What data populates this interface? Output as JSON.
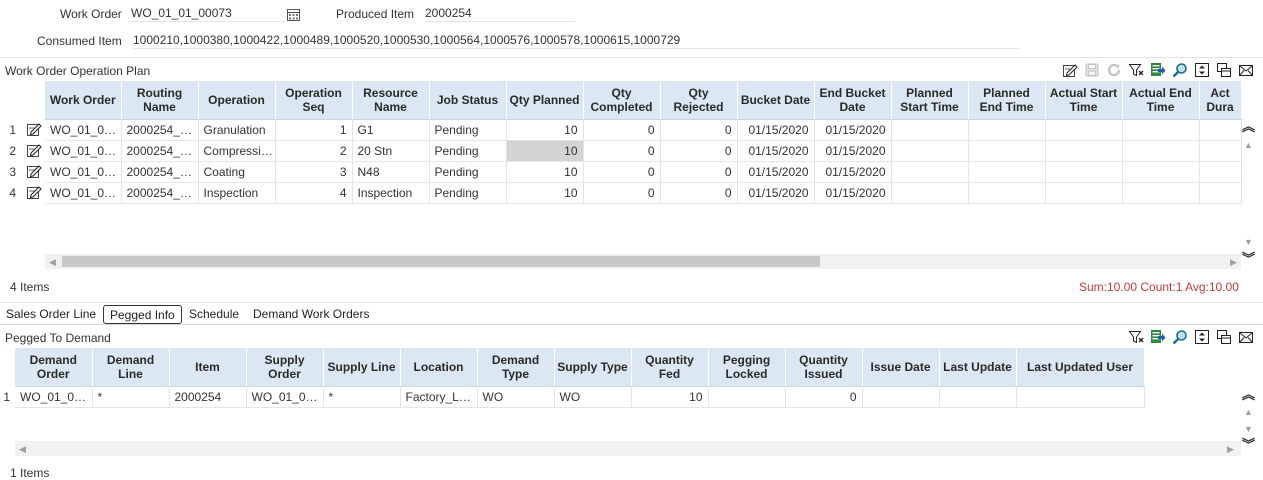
{
  "header": {
    "work_order_label": "Work Order",
    "work_order_value": "WO_01_01_00073",
    "produced_item_label": "Produced Item",
    "produced_item_value": "2000254",
    "consumed_item_label": "Consumed Item",
    "consumed_item_value": "1000210,1000380,1000422,1000489,1000520,1000530,1000564,1000576,1000578,1000615,1000729"
  },
  "op_plan": {
    "title": "Work Order Operation Plan",
    "columns": [
      "Work Order",
      "Routing Name",
      "Operation",
      "Operation Seq",
      "Resource Name",
      "Job Status",
      "Qty Planned",
      "Qty Completed",
      "Qty Rejected",
      "Bucket Date",
      "End Bucket Date",
      "Planned Start Time",
      "Planned End Time",
      "Actual Start Time",
      "Actual End Time",
      "Act Dura"
    ],
    "rows": [
      {
        "n": "1",
        "cells": [
          "WO_01_0…",
          "2000254_…",
          "Granulation",
          "1",
          "G1",
          "Pending",
          "10",
          "0",
          "0",
          "01/15/2020",
          "01/15/2020",
          "",
          "",
          "",
          "",
          ""
        ]
      },
      {
        "n": "2",
        "cells": [
          "WO_01_0…",
          "2000254_…",
          "Compressi…",
          "2",
          "20 Stn",
          "Pending",
          "10",
          "0",
          "0",
          "01/15/2020",
          "01/15/2020",
          "",
          "",
          "",
          "",
          ""
        ]
      },
      {
        "n": "3",
        "cells": [
          "WO_01_0…",
          "2000254_…",
          "Coating",
          "3",
          "N48",
          "Pending",
          "10",
          "0",
          "0",
          "01/15/2020",
          "01/15/2020",
          "",
          "",
          "",
          "",
          ""
        ]
      },
      {
        "n": "4",
        "cells": [
          "WO_01_0…",
          "2000254_…",
          "Inspection",
          "4",
          "Inspection",
          "Pending",
          "10",
          "0",
          "0",
          "01/15/2020",
          "01/15/2020",
          "",
          "",
          "",
          "",
          ""
        ]
      }
    ],
    "item_count": "4 Items",
    "summary": "Sum:10.00 Count:1 Avg:10.00"
  },
  "tabs": [
    "Sales Order Line",
    "Pegged Info",
    "Schedule",
    "Demand Work Orders"
  ],
  "active_tab": "Pegged Info",
  "pegged": {
    "title": "Pegged To Demand",
    "columns": [
      "Demand Order",
      "Demand Line",
      "Item",
      "Supply Order",
      "Supply Line",
      "Location",
      "Demand Type",
      "Supply Type",
      "Quantity Fed",
      "Pegging Locked",
      "Quantity Issued",
      "Issue Date",
      "Last Update",
      "Last Updated User"
    ],
    "rows": [
      {
        "n": "1",
        "cells": [
          "WO_01_0…",
          "*",
          "2000254",
          "WO_01_0…",
          "*",
          "Factory_L…",
          "WO",
          "WO",
          "10",
          "",
          "0",
          "",
          "",
          ""
        ]
      }
    ],
    "item_count": "1 Items"
  },
  "icons": {
    "toolbar_top": [
      "edit-icon",
      "save-icon",
      "refresh-icon",
      "filter-icon",
      "export-icon",
      "find-icon",
      "resize-icon",
      "columns-icon",
      "email-icon"
    ],
    "toolbar_bottom": [
      "filter-icon",
      "export-icon",
      "find-icon",
      "resize-icon",
      "columns-icon",
      "email-icon"
    ]
  },
  "colors": {
    "header_bg": "#dbe8f3",
    "summary": "#c23b3b",
    "highlight_cell": "#d4d4d4"
  }
}
